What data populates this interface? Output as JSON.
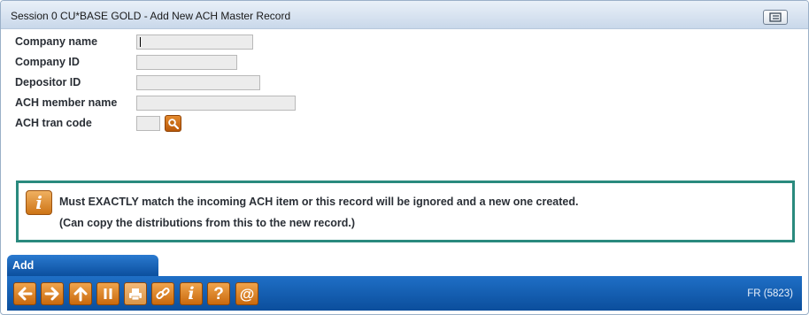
{
  "window": {
    "title": "Session 0 CU*BASE GOLD - Add New ACH Master Record"
  },
  "form": {
    "fields": [
      {
        "label": "Company name",
        "value": ""
      },
      {
        "label": "Company ID",
        "value": ""
      },
      {
        "label": "Depositor ID",
        "value": ""
      },
      {
        "label": "ACH member name",
        "value": ""
      },
      {
        "label": "ACH tran code",
        "value": ""
      }
    ]
  },
  "info": {
    "icon": "info-icon",
    "line1": "Must EXACTLY match the incoming ACH item or this record will be ignored and a new one created.",
    "line2": "(Can copy the distributions from this to the new record.)"
  },
  "action_tab": {
    "label": "Add"
  },
  "toolbar": {
    "buttons": [
      "back-icon",
      "forward-icon",
      "up-icon",
      "pause-icon",
      "print-icon",
      "link-icon",
      "info-icon",
      "help-icon",
      "at-icon"
    ],
    "screen_id": "FR (5823)"
  },
  "colors": {
    "accent": "#0b4f9e",
    "button": "#d9761a",
    "info_border": "#2a8a7e"
  }
}
